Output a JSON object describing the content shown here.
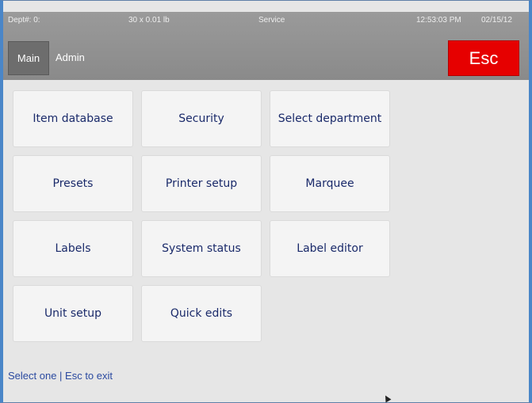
{
  "header": {
    "dept": "Dept#: 0:",
    "weight": "30 x 0.01 lb",
    "mode": "Service",
    "time": "12:53:03 PM",
    "date": "02/15/12"
  },
  "nav": {
    "main_tab": "Main",
    "admin_tab": "Admin",
    "esc_label": "Esc"
  },
  "menu": {
    "item_database": "Item database",
    "security": "Security",
    "select_department": "Select department",
    "presets": "Presets",
    "printer_setup": "Printer setup",
    "marquee": "Marquee",
    "labels": "Labels",
    "system_status": "System status",
    "label_editor": "Label editor",
    "unit_setup": "Unit setup",
    "quick_edits": "Quick edits"
  },
  "status": "Select one | Esc to exit",
  "colors": {
    "esc": "#e60000",
    "header": "#8f8f8f",
    "button_text": "#1a2a6a",
    "status_text": "#2b4aa0"
  }
}
